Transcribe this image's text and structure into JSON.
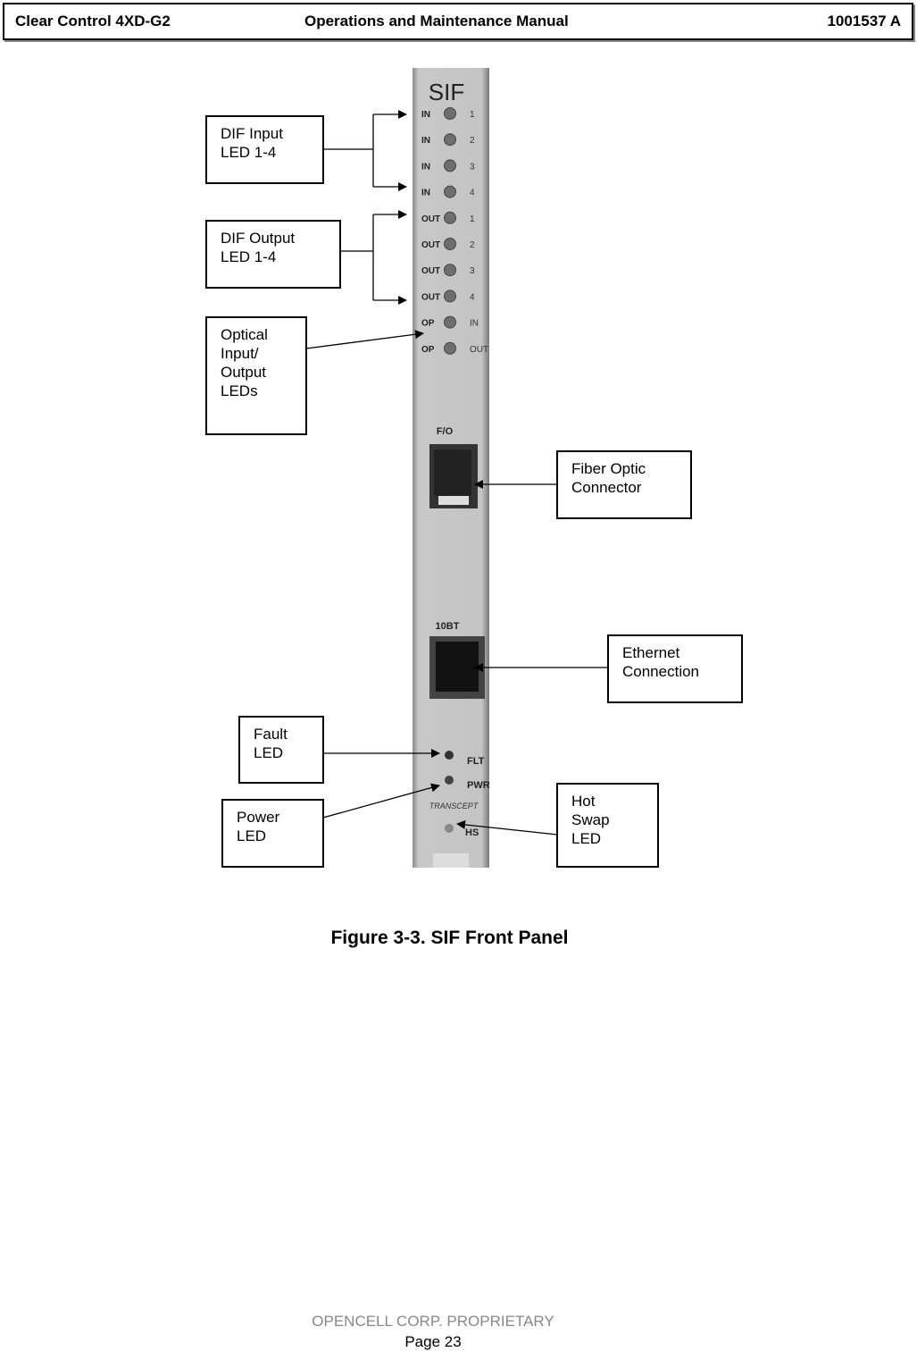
{
  "header": {
    "left": "Clear Control 4XD-G2",
    "center": "Operations and Maintenance Manual",
    "right": "1001537 A"
  },
  "figure": {
    "caption": "Figure 3-3.  SIF Front Panel",
    "panel": {
      "title": "SIF",
      "leds": [
        {
          "left": "IN",
          "right": "1"
        },
        {
          "left": "IN",
          "right": "2"
        },
        {
          "left": "IN",
          "right": "3"
        },
        {
          "left": "IN",
          "right": "4"
        },
        {
          "left": "OUT",
          "right": "1"
        },
        {
          "left": "OUT",
          "right": "2"
        },
        {
          "left": "OUT",
          "right": "3"
        },
        {
          "left": "OUT",
          "right": "4"
        },
        {
          "left": "OP",
          "right": "IN"
        },
        {
          "left": "OP",
          "right": "OUT"
        }
      ],
      "fo_label": "F/O",
      "ethernet_label": "10BT",
      "bottom_leds": [
        "FLT",
        "PWR",
        "HS"
      ],
      "logo": "TRANSCEPT"
    },
    "callouts": {
      "dif_input": "DIF Input\nLED 1-4",
      "dif_output": "DIF Output\nLED 1-4",
      "optical": "Optical\nInput/\nOutput\nLEDs",
      "fiber": "Fiber Optic\nConnector",
      "ethernet": "Ethernet\nConnection",
      "fault": "Fault\nLED",
      "power": "Power\nLED",
      "hotswap": "Hot\nSwap\nLED"
    }
  },
  "footer": {
    "proprietary": "OPENCELL CORP.  PROPRIETARY",
    "page": "Page 23"
  }
}
